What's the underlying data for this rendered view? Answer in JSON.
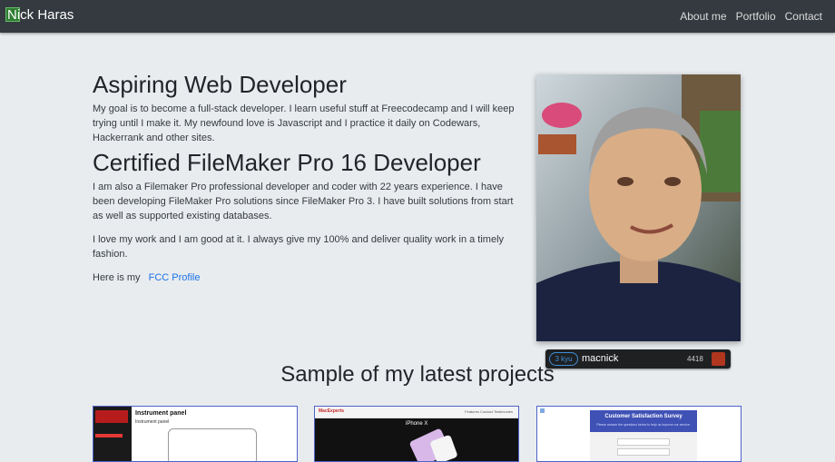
{
  "navbar": {
    "brand": "Nick Haras",
    "links": [
      "About me",
      "Portfolio",
      "Contact"
    ]
  },
  "about": {
    "heading1": "Aspiring Web Developer",
    "paragraph1": "My goal is to become a full-stack developer. I learn useful stuff at Freecodecamp and I will keep trying until I make it. My newfound love is Javascript and I practice it daily on Codewars, Hackerrank and other sites.",
    "heading2": "Certified FileMaker Pro 16 Developer",
    "paragraph2": "I am also a Filemaker Pro professional developer and coder with 22 years experience. I have been developing FileMaker Pro solutions since FileMaker Pro 3. I have built solutions from start as well as supported existing databases.",
    "paragraph3": "I love my work and I am good at it. I always give my 100% and deliver quality work in a timely fashion.",
    "profile_prefix": "Here is my",
    "profile_link": "FCC Profile"
  },
  "codewars": {
    "rank": "3 kyu",
    "username": "macnick",
    "honor": "4418"
  },
  "projects": {
    "title": "Sample of my latest projects",
    "card1": {
      "title": "Instrument panel",
      "subtitle": "Instrument panel"
    },
    "card2": {
      "logo": "MacExperts",
      "nav": "Features  Contact  Testimonies",
      "product": "iPhone X"
    },
    "card3": {
      "title": "Customer Satisfaction Survey",
      "subtitle": "Please answer the questions below to help us improve our service."
    }
  },
  "colors": {
    "navbar": "#343a40",
    "background": "#e9ecef",
    "link": "#1a73e8",
    "card_border": "#4d63c9"
  }
}
